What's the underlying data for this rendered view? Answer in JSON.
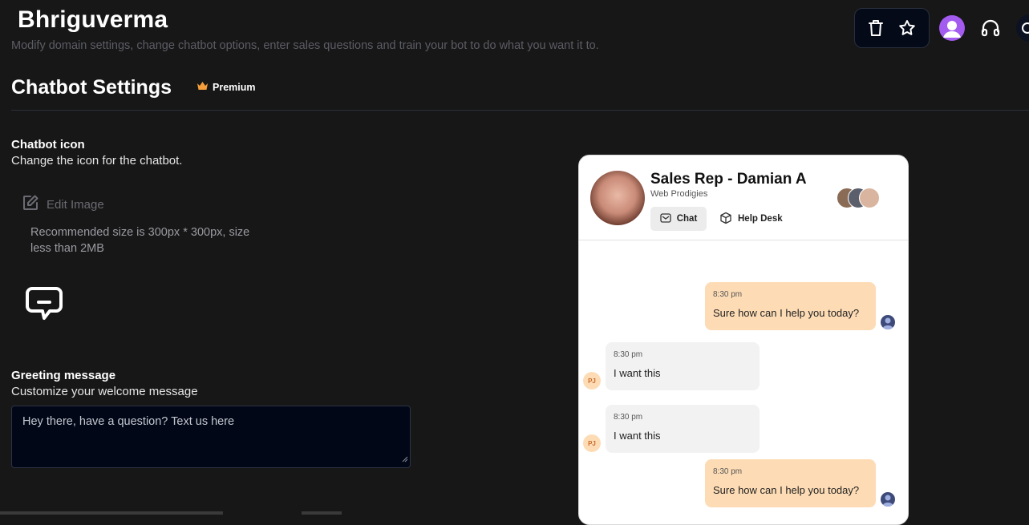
{
  "header": {
    "title": "Bhriguverma",
    "subtitle": "Modify domain settings, change chatbot options, enter sales questions and train your bot to do what you want it to."
  },
  "topbar": {
    "icons": [
      "trash-icon",
      "star-icon",
      "user-avatar-icon",
      "headset-icon",
      "search-icon"
    ],
    "accent": "#a45cf0"
  },
  "section": {
    "title": "Chatbot Settings",
    "badge": "Premium"
  },
  "chatbot_icon": {
    "label": "Chatbot icon",
    "description": "Change the icon for the chatbot.",
    "edit_label": "Edit Image",
    "recommendation": "Recommended size is 300px * 300px, size less than 2MB"
  },
  "greeting": {
    "label": "Greeting message",
    "description": "Customize your welcome message",
    "value": "Hey there, have  a question? Text us here"
  },
  "preview": {
    "rep_name": "Sales Rep - Damian A",
    "company": "Web Prodigies",
    "tabs": [
      "Chat",
      "Help Desk"
    ],
    "messages": [
      {
        "from": "bot",
        "time": "8:30 pm",
        "text": "Sure how can I help you today?"
      },
      {
        "from": "user",
        "initials": "PJ",
        "time": "8:30 pm",
        "text": "I want this"
      },
      {
        "from": "user",
        "initials": "PJ",
        "time": "8:30 pm",
        "text": "I want this"
      },
      {
        "from": "bot",
        "time": "8:30 pm",
        "text": "Sure how can I help you today?"
      }
    ],
    "colors": {
      "outgoing": "#fddcb5",
      "incoming": "#f2f2f2"
    }
  }
}
